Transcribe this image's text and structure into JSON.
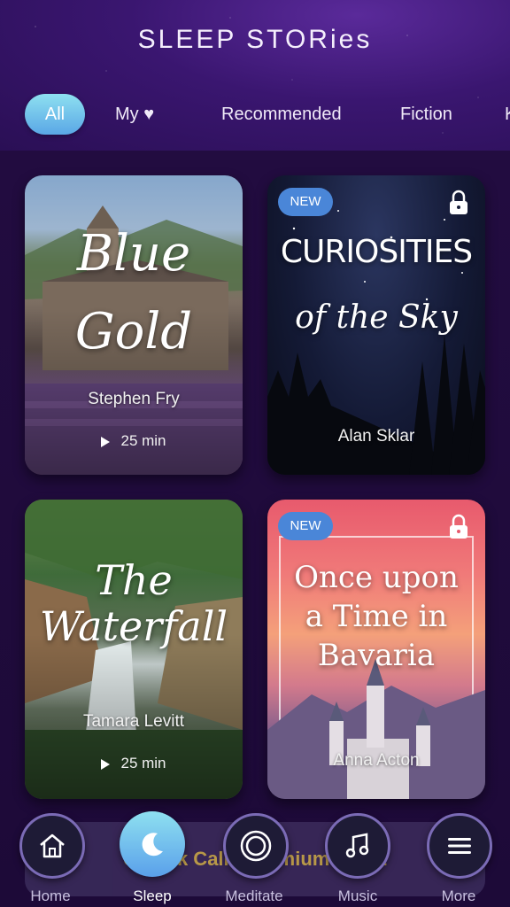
{
  "header": {
    "title": "SLEEP STORies"
  },
  "tabs": [
    {
      "label": "All",
      "active": true
    },
    {
      "label": "My ♥",
      "active": false
    },
    {
      "label": "Recommended",
      "active": false
    },
    {
      "label": "Fiction",
      "active": false
    },
    {
      "label": "K",
      "active": false
    }
  ],
  "stories": [
    {
      "title_line1": "Blue",
      "title_line2": "Gold",
      "author": "Stephen Fry",
      "duration": "25 min",
      "badge": "",
      "locked": false
    },
    {
      "title_line1": "CURIOSITIES",
      "title_line2": "of the Sky",
      "author": "Alan Sklar",
      "duration": "",
      "badge": "NEW",
      "locked": true
    },
    {
      "title_line1": "The",
      "title_line2": "Waterfall",
      "author": "Tamara Levitt",
      "duration": "25 min",
      "badge": "",
      "locked": false
    },
    {
      "title_line1": "Once upon",
      "title_line2": "a Time in",
      "title_line3": "Bavaria",
      "author": "Anna Acton",
      "duration": "",
      "badge": "NEW",
      "locked": true
    }
  ],
  "promo": {
    "text": "Unlock Calm Premium FREE"
  },
  "nav": [
    {
      "label": "Home",
      "icon": "home-icon"
    },
    {
      "label": "Sleep",
      "icon": "moon-icon",
      "active": true
    },
    {
      "label": "Meditate",
      "icon": "meditate-icon"
    },
    {
      "label": "Music",
      "icon": "music-icon"
    },
    {
      "label": "More",
      "icon": "menu-icon"
    }
  ],
  "colors": {
    "accent": "#6fc3ec",
    "badge": "#4a86d8",
    "background": "#1e0b3a"
  }
}
